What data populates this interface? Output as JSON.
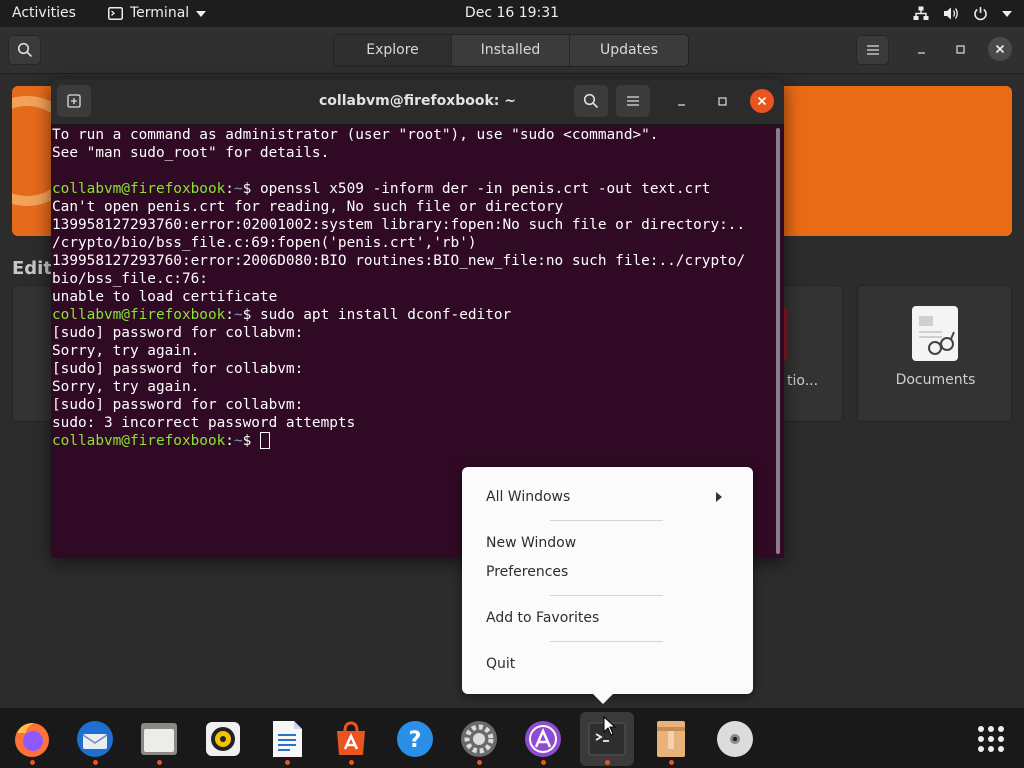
{
  "topbar": {
    "activities": "Activities",
    "app_name": "Terminal",
    "clock": "Dec 16  19:31"
  },
  "software": {
    "tabs": [
      "Explore",
      "Installed",
      "Updates"
    ],
    "editors_heading": "Editors",
    "card_mid_label": "tio...",
    "documents_label": "Documents"
  },
  "terminal": {
    "title": "collabvm@firefoxbook: ~",
    "lines": [
      {
        "text": "To run a command as administrator (user \"root\"), use \"sudo <command>\"."
      },
      {
        "text": "See \"man sudo_root\" for details."
      },
      {
        "text": ""
      },
      {
        "user": "collabvm@firefoxbook",
        "path": "~",
        "text": "$ openssl x509 -inform der -in penis.crt -out text.crt"
      },
      {
        "text": "Can't open penis.crt for reading, No such file or directory"
      },
      {
        "text": "139958127293760:error:02001002:system library:fopen:No such file or directory:.."
      },
      {
        "text": "/crypto/bio/bss_file.c:69:fopen('penis.crt','rb')"
      },
      {
        "text": "139958127293760:error:2006D080:BIO routines:BIO_new_file:no such file:../crypto/"
      },
      {
        "text": "bio/bss_file.c:76:"
      },
      {
        "text": "unable to load certificate"
      },
      {
        "user": "collabvm@firefoxbook",
        "path": "~",
        "text": "$ sudo apt install dconf-editor"
      },
      {
        "text": "[sudo] password for collabvm:"
      },
      {
        "text": "Sorry, try again."
      },
      {
        "text": "[sudo] password for collabvm:"
      },
      {
        "text": "Sorry, try again."
      },
      {
        "text": "[sudo] password for collabvm:"
      },
      {
        "text": "sudo: 3 incorrect password attempts"
      },
      {
        "user": "collabvm@firefoxbook",
        "path": "~",
        "text": "$ ",
        "cursor": true
      }
    ]
  },
  "context_menu": {
    "all_windows": "All Windows",
    "new_window": "New Window",
    "preferences": "Preferences",
    "add_to_favorites": "Add to Favorites",
    "quit": "Quit"
  },
  "dock": {
    "items": [
      "firefox-icon",
      "thunderbird-icon",
      "files-icon",
      "rhythmbox-icon",
      "writer-icon",
      "software-icon",
      "help-icon",
      "settings-icon",
      "app-center-icon",
      "terminal-icon",
      "archive-icon",
      "disc-icon",
      "show-apps-icon"
    ]
  },
  "colors": {
    "terminal_bg": "#300a24",
    "prompt_user": "#8ae234",
    "prompt_path": "#729fcf",
    "accent": "#e95420"
  }
}
